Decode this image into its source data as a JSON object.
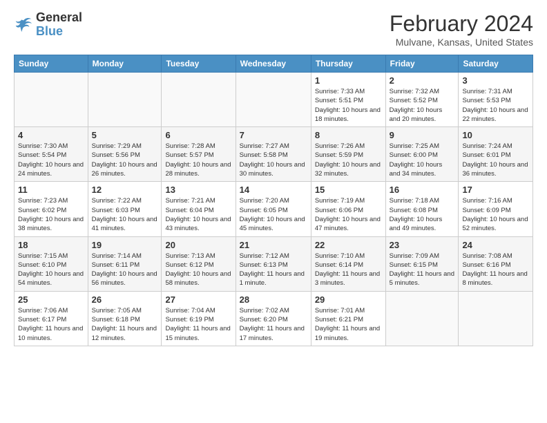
{
  "logo": {
    "text_general": "General",
    "text_blue": "Blue"
  },
  "header": {
    "month": "February 2024",
    "location": "Mulvane, Kansas, United States"
  },
  "days_of_week": [
    "Sunday",
    "Monday",
    "Tuesday",
    "Wednesday",
    "Thursday",
    "Friday",
    "Saturday"
  ],
  "weeks": [
    [
      {
        "day": "",
        "info": ""
      },
      {
        "day": "",
        "info": ""
      },
      {
        "day": "",
        "info": ""
      },
      {
        "day": "",
        "info": ""
      },
      {
        "day": "1",
        "info": "Sunrise: 7:33 AM\nSunset: 5:51 PM\nDaylight: 10 hours\nand 18 minutes."
      },
      {
        "day": "2",
        "info": "Sunrise: 7:32 AM\nSunset: 5:52 PM\nDaylight: 10 hours\nand 20 minutes."
      },
      {
        "day": "3",
        "info": "Sunrise: 7:31 AM\nSunset: 5:53 PM\nDaylight: 10 hours\nand 22 minutes."
      }
    ],
    [
      {
        "day": "4",
        "info": "Sunrise: 7:30 AM\nSunset: 5:54 PM\nDaylight: 10 hours\nand 24 minutes."
      },
      {
        "day": "5",
        "info": "Sunrise: 7:29 AM\nSunset: 5:56 PM\nDaylight: 10 hours\nand 26 minutes."
      },
      {
        "day": "6",
        "info": "Sunrise: 7:28 AM\nSunset: 5:57 PM\nDaylight: 10 hours\nand 28 minutes."
      },
      {
        "day": "7",
        "info": "Sunrise: 7:27 AM\nSunset: 5:58 PM\nDaylight: 10 hours\nand 30 minutes."
      },
      {
        "day": "8",
        "info": "Sunrise: 7:26 AM\nSunset: 5:59 PM\nDaylight: 10 hours\nand 32 minutes."
      },
      {
        "day": "9",
        "info": "Sunrise: 7:25 AM\nSunset: 6:00 PM\nDaylight: 10 hours\nand 34 minutes."
      },
      {
        "day": "10",
        "info": "Sunrise: 7:24 AM\nSunset: 6:01 PM\nDaylight: 10 hours\nand 36 minutes."
      }
    ],
    [
      {
        "day": "11",
        "info": "Sunrise: 7:23 AM\nSunset: 6:02 PM\nDaylight: 10 hours\nand 38 minutes."
      },
      {
        "day": "12",
        "info": "Sunrise: 7:22 AM\nSunset: 6:03 PM\nDaylight: 10 hours\nand 41 minutes."
      },
      {
        "day": "13",
        "info": "Sunrise: 7:21 AM\nSunset: 6:04 PM\nDaylight: 10 hours\nand 43 minutes."
      },
      {
        "day": "14",
        "info": "Sunrise: 7:20 AM\nSunset: 6:05 PM\nDaylight: 10 hours\nand 45 minutes."
      },
      {
        "day": "15",
        "info": "Sunrise: 7:19 AM\nSunset: 6:06 PM\nDaylight: 10 hours\nand 47 minutes."
      },
      {
        "day": "16",
        "info": "Sunrise: 7:18 AM\nSunset: 6:08 PM\nDaylight: 10 hours\nand 49 minutes."
      },
      {
        "day": "17",
        "info": "Sunrise: 7:16 AM\nSunset: 6:09 PM\nDaylight: 10 hours\nand 52 minutes."
      }
    ],
    [
      {
        "day": "18",
        "info": "Sunrise: 7:15 AM\nSunset: 6:10 PM\nDaylight: 10 hours\nand 54 minutes."
      },
      {
        "day": "19",
        "info": "Sunrise: 7:14 AM\nSunset: 6:11 PM\nDaylight: 10 hours\nand 56 minutes."
      },
      {
        "day": "20",
        "info": "Sunrise: 7:13 AM\nSunset: 6:12 PM\nDaylight: 10 hours\nand 58 minutes."
      },
      {
        "day": "21",
        "info": "Sunrise: 7:12 AM\nSunset: 6:13 PM\nDaylight: 11 hours\nand 1 minute."
      },
      {
        "day": "22",
        "info": "Sunrise: 7:10 AM\nSunset: 6:14 PM\nDaylight: 11 hours\nand 3 minutes."
      },
      {
        "day": "23",
        "info": "Sunrise: 7:09 AM\nSunset: 6:15 PM\nDaylight: 11 hours\nand 5 minutes."
      },
      {
        "day": "24",
        "info": "Sunrise: 7:08 AM\nSunset: 6:16 PM\nDaylight: 11 hours\nand 8 minutes."
      }
    ],
    [
      {
        "day": "25",
        "info": "Sunrise: 7:06 AM\nSunset: 6:17 PM\nDaylight: 11 hours\nand 10 minutes."
      },
      {
        "day": "26",
        "info": "Sunrise: 7:05 AM\nSunset: 6:18 PM\nDaylight: 11 hours\nand 12 minutes."
      },
      {
        "day": "27",
        "info": "Sunrise: 7:04 AM\nSunset: 6:19 PM\nDaylight: 11 hours\nand 15 minutes."
      },
      {
        "day": "28",
        "info": "Sunrise: 7:02 AM\nSunset: 6:20 PM\nDaylight: 11 hours\nand 17 minutes."
      },
      {
        "day": "29",
        "info": "Sunrise: 7:01 AM\nSunset: 6:21 PM\nDaylight: 11 hours\nand 19 minutes."
      },
      {
        "day": "",
        "info": ""
      },
      {
        "day": "",
        "info": ""
      }
    ]
  ]
}
